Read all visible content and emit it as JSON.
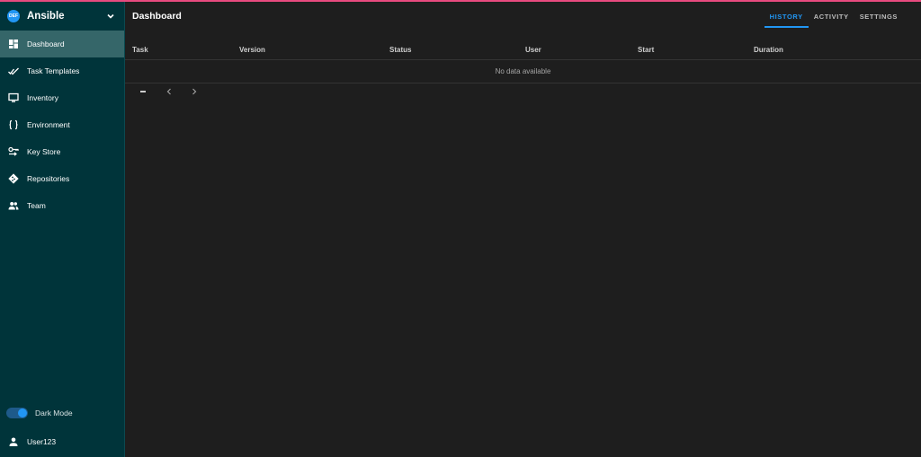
{
  "app": {
    "accent": "#2196f3",
    "top_bar_color": "#e84a7f"
  },
  "sidebar": {
    "logo_text": "DEF",
    "project_name": "Ansible",
    "items": [
      {
        "label": "Dashboard",
        "icon": "dashboard-icon",
        "active": true
      },
      {
        "label": "Task Templates",
        "icon": "check-all-icon"
      },
      {
        "label": "Inventory",
        "icon": "monitor-icon"
      },
      {
        "label": "Environment",
        "icon": "braces-icon"
      },
      {
        "label": "Key Store",
        "icon": "key-change-icon"
      },
      {
        "label": "Repositories",
        "icon": "git-icon"
      },
      {
        "label": "Team",
        "icon": "account-multiple-icon"
      }
    ],
    "dark_mode_label": "Dark Mode",
    "dark_mode_on": true,
    "user_name": "User123"
  },
  "main": {
    "title": "Dashboard",
    "tabs": [
      {
        "label": "HISTORY",
        "active": true
      },
      {
        "label": "ACTIVITY"
      },
      {
        "label": "SETTINGS"
      }
    ],
    "table": {
      "columns": [
        "Task",
        "Version",
        "Status",
        "User",
        "Start",
        "Duration"
      ],
      "empty_text": "No data available"
    }
  }
}
